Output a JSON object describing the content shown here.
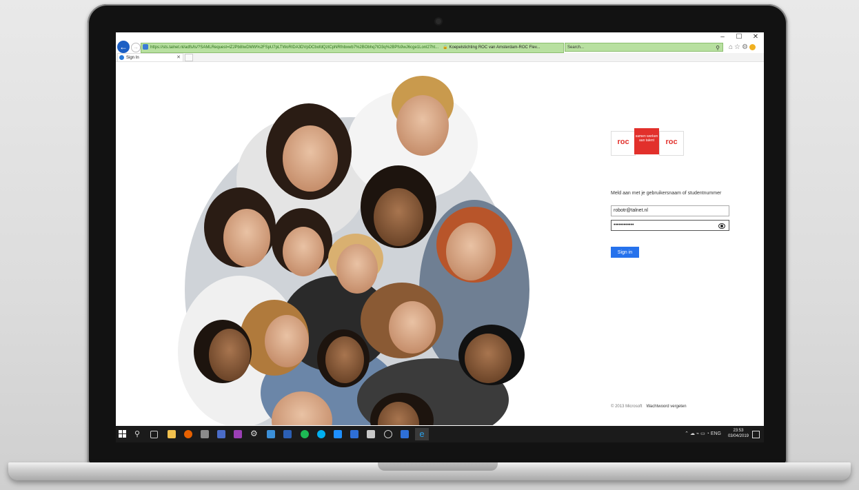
{
  "browser": {
    "window_controls": [
      "–",
      "☐",
      "✕"
    ],
    "address_url": "https://sts.talnet.nl/adfs/ls/?SAMLRequest=lZJPb8IwDMW%2FSpU7pLTWoRIDA3DVpDCbofdQztCpNRfnbxwb7%2BObhq7tO3q%2BPfs9wJ6cge1Lonl27ht...",
    "address_lock": "🔒",
    "address_site": "Koepelstichting ROC van Amsterdam-ROC Flev...",
    "search_placeholder": "Search...",
    "tab_title": "Sign In"
  },
  "brand": {
    "accent_blue": "#2672ec",
    "logo_red": "#e2302b",
    "logo_left": "roc",
    "logo_middle": "samen werken aan talent",
    "logo_right": "roc"
  },
  "login": {
    "prompt": "Meld aan met je gebruikersnaam of studentnummer",
    "username_value": "robotr@talnet.nl",
    "password_value": "••••••••••••",
    "signin_label": "Sign in",
    "footer_copyright": "© 2013 Microsoft",
    "footer_link": "Wachtwoord vergeten"
  },
  "taskbar": {
    "icons": [
      "start-icon",
      "search-icon",
      "task-view-icon",
      "file-explorer-icon",
      "firefox-icon",
      "app-icon",
      "app-icon",
      "app-icon",
      "settings-icon",
      "app-icon",
      "word-icon",
      "spotify-icon",
      "skype-icon",
      "app-icon",
      "uipath-icon",
      "app-icon",
      "chrome-icon",
      "uipath-icon",
      "ie-icon"
    ],
    "language": "ENG",
    "time": "23:53",
    "date": "03/04/2019"
  }
}
